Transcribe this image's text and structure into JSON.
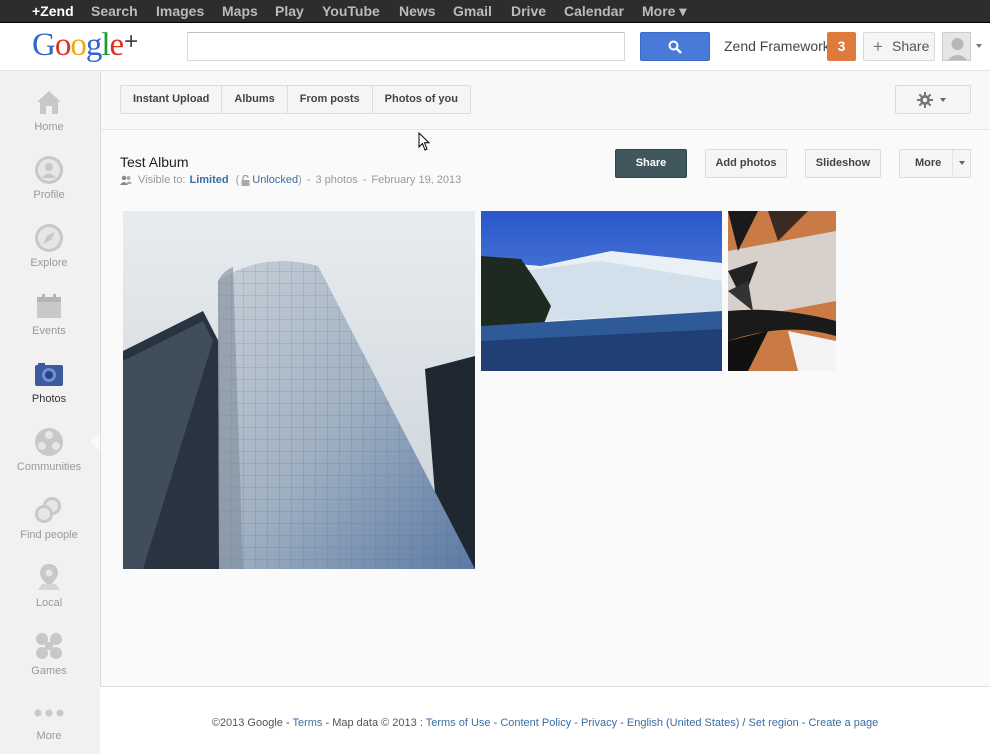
{
  "topbar": {
    "items": [
      "+Zend",
      "Search",
      "Images",
      "Maps",
      "Play",
      "YouTube",
      "News",
      "Gmail",
      "Drive",
      "Calendar",
      "More ▾"
    ]
  },
  "header": {
    "logo_text": "Google",
    "logo_plus": "+",
    "search_placeholder": "",
    "user_name": "Zend Framework",
    "notification_count": "3",
    "share_label": "Share"
  },
  "sidebar": {
    "items": [
      {
        "label": "Home",
        "icon": "home-icon"
      },
      {
        "label": "Profile",
        "icon": "profile-icon"
      },
      {
        "label": "Explore",
        "icon": "compass-icon"
      },
      {
        "label": "Events",
        "icon": "calendar-icon"
      },
      {
        "label": "Photos",
        "icon": "camera-icon"
      },
      {
        "label": "Communities",
        "icon": "communities-icon"
      },
      {
        "label": "Find people",
        "icon": "find-people-icon"
      },
      {
        "label": "Local",
        "icon": "map-pin-icon"
      },
      {
        "label": "Games",
        "icon": "games-icon"
      },
      {
        "label": "More",
        "icon": "more-dots-icon"
      }
    ],
    "active": "Photos"
  },
  "tabs": [
    "Instant Upload",
    "Albums",
    "From posts",
    "Photos of you"
  ],
  "album": {
    "title": "Test Album",
    "visible_to": "Visible to:",
    "visibility": "Limited",
    "lock_state": "Unlocked",
    "photo_count": "3 photos",
    "date": "February 19, 2013"
  },
  "actions": {
    "share": "Share",
    "add_photos": "Add photos",
    "slideshow": "Slideshow",
    "more": "More"
  },
  "photos": [
    {
      "subject": "glass skyscraper"
    },
    {
      "subject": "waterfall"
    },
    {
      "subject": "palm leaves"
    }
  ],
  "footer": {
    "copyright": "©2013 Google - ",
    "terms": "Terms",
    "map_data": " - Map data © 2013 : ",
    "terms_of_use": "Terms of Use",
    "dash1": " - ",
    "content_policy": "Content Policy",
    "dash2": " - ",
    "privacy": "Privacy",
    "dash3": " - ",
    "language": "English (United States)",
    "slash": " / ",
    "set_region": "Set region",
    "dash4": " - ",
    "create_page": "Create a page"
  },
  "colors": {
    "topbar": "#2d2d2d",
    "search_button": "#4a7ad8",
    "notification": "#dd7a3c",
    "share_button": "#40575e",
    "link": "#3a6ea5"
  }
}
